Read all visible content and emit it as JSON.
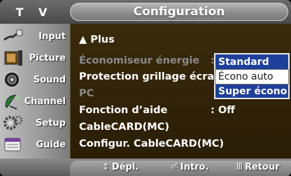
{
  "header": {
    "device_label": "T V",
    "title": "Configuration"
  },
  "sidebar": {
    "items": [
      {
        "label": "Input",
        "icon": "input-plug-icon"
      },
      {
        "label": "Picture",
        "icon": "picture-film-icon"
      },
      {
        "label": "Sound",
        "icon": "sound-speaker-icon"
      },
      {
        "label": "Channel",
        "icon": "channel-dish-icon"
      },
      {
        "label": "Setup",
        "icon": "setup-gears-icon"
      },
      {
        "label": "Guide",
        "icon": "guide-program-icon"
      }
    ]
  },
  "menu": {
    "items": [
      {
        "label": "▲ Plus",
        "value": "",
        "enabled": true
      },
      {
        "label": "Économiseur énergie",
        "value": ":",
        "enabled": false
      },
      {
        "label": "Protection grillage écran",
        "value": "",
        "enabled": true
      },
      {
        "label": "PC",
        "value": "",
        "enabled": false
      },
      {
        "label": "Fonction d’aide",
        "value": ": Off",
        "enabled": true
      },
      {
        "label": "CableCARD(MC)",
        "value": "",
        "enabled": true
      },
      {
        "label": "Configur. CableCARD(MC)",
        "value": "",
        "enabled": true
      }
    ]
  },
  "dropdown": {
    "options": [
      "Standard",
      "Écono auto",
      "Super écono"
    ],
    "selected": "Écono auto"
  },
  "footer": {
    "move": {
      "glyph": "⇕",
      "label": "Dépl."
    },
    "enter": {
      "glyph": "⏎",
      "label": "Intro."
    },
    "return": {
      "glyph": "Ⅲ",
      "label": "Retour"
    }
  },
  "colors": {
    "dropdown_bg": "#1e3f9a",
    "panel_bg": "#2b1e07",
    "disabled_text": "#8a8a8a"
  }
}
